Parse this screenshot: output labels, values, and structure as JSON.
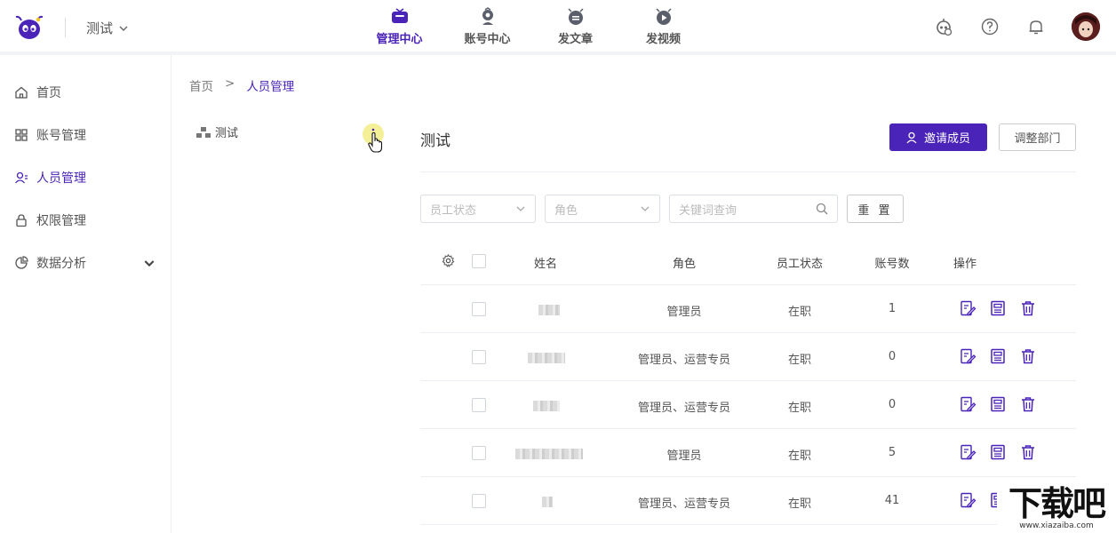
{
  "header": {
    "workspace": "测试",
    "nav": [
      {
        "label": "管理中心",
        "icon": "tv-icon",
        "active": true
      },
      {
        "label": "账号中心",
        "icon": "account-icon",
        "active": false
      },
      {
        "label": "发文章",
        "icon": "article-icon",
        "active": false
      },
      {
        "label": "发视频",
        "icon": "video-icon",
        "active": false
      }
    ],
    "right_icons": [
      "robot-icon",
      "help-icon",
      "bell-icon",
      "avatar"
    ]
  },
  "sidebar": {
    "items": [
      {
        "label": "首页",
        "icon": "home-icon",
        "active": false
      },
      {
        "label": "账号管理",
        "icon": "grid-icon",
        "active": false
      },
      {
        "label": "人员管理",
        "icon": "user-icon",
        "active": true
      },
      {
        "label": "权限管理",
        "icon": "lock-icon",
        "active": false
      },
      {
        "label": "数据分析",
        "icon": "pie-icon",
        "active": false,
        "expandable": true
      }
    ]
  },
  "breadcrumb": {
    "home": "首页",
    "sep": ">",
    "current": "人员管理"
  },
  "tree": {
    "root": "测试"
  },
  "section": {
    "title": "测试",
    "invite_label": "邀请成员",
    "adjust_label": "调整部门"
  },
  "filters": {
    "status_placeholder": "员工状态",
    "role_placeholder": "角色",
    "search_placeholder": "关键词查询",
    "reset_label": "重 置"
  },
  "table": {
    "columns": [
      "姓名",
      "角色",
      "员工状态",
      "账号数",
      "操作"
    ],
    "rows": [
      {
        "role": "管理员",
        "status": "在职",
        "accounts": "1"
      },
      {
        "role": "管理员、运营专员",
        "status": "在职",
        "accounts": "0"
      },
      {
        "role": "管理员、运营专员",
        "status": "在职",
        "accounts": "0"
      },
      {
        "role": "管理员",
        "status": "在职",
        "accounts": "5"
      },
      {
        "role": "管理员、运营专员",
        "status": "在职",
        "accounts": "41"
      }
    ]
  },
  "watermark": {
    "text": "下载吧",
    "url": "www.xiazaiba.com"
  },
  "colors": {
    "accent": "#4a23b8",
    "border": "#eceef3"
  }
}
